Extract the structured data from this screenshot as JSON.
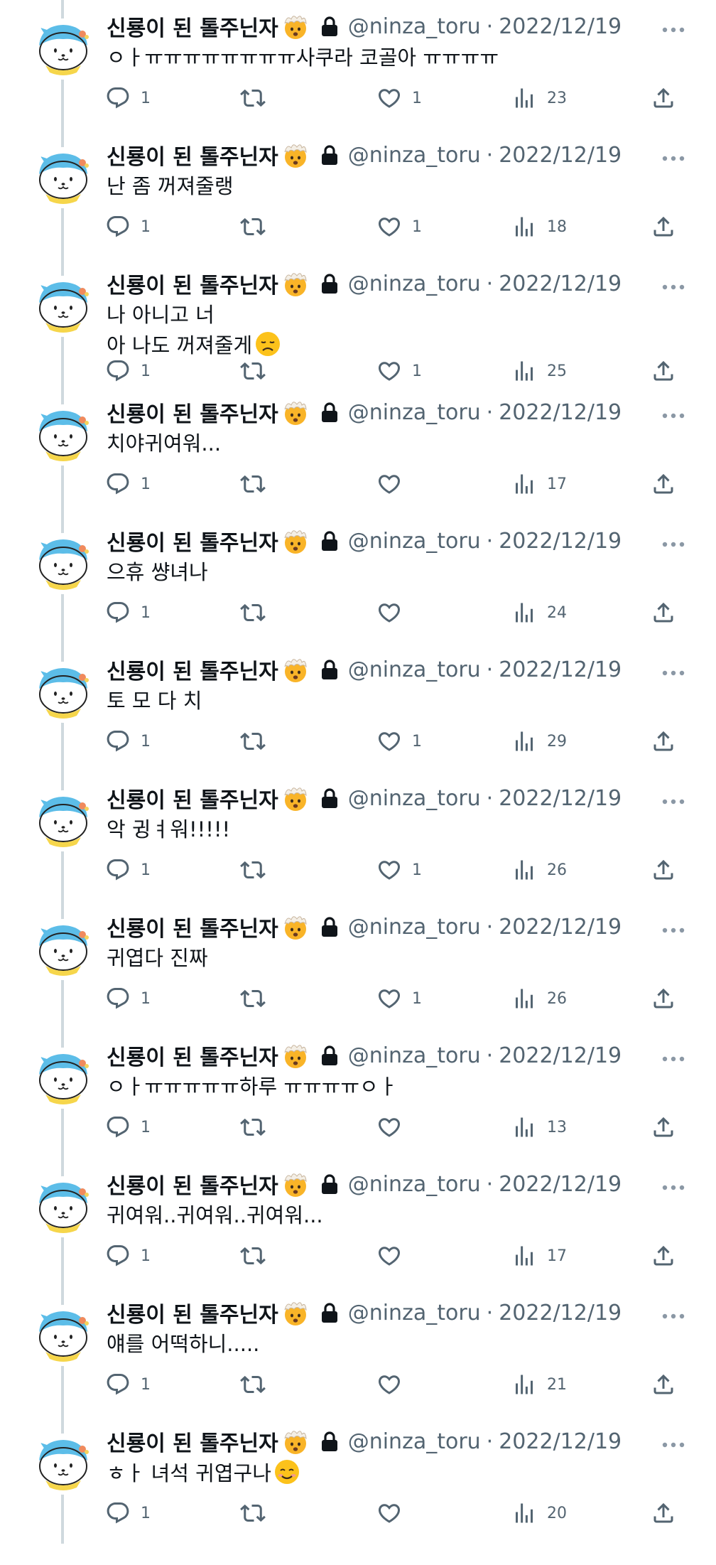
{
  "author": {
    "display_name": "신룡이 된 톨주닌자",
    "handle": "@ninza_toru",
    "name_emoji": "exploding-head-emoji",
    "locked_icon": "lock-icon",
    "avatar": "shark-hood-character-avatar"
  },
  "separator": "·",
  "colors": {
    "text": "#0f1419",
    "secondary": "#536471",
    "thread_line": "#cfd9de"
  },
  "icons": [
    "reply-icon",
    "retweet-icon",
    "like-icon",
    "views-icon",
    "share-icon",
    "more-icon"
  ],
  "tweets": [
    {
      "date": "2022/12/19",
      "text": "ㅇㅏㅠㅠㅠㅠㅠㅠㅠㅠ사쿠라 코골아 ㅠㅠㅠㅠ",
      "replies": "1",
      "likes": "1",
      "views": "23"
    },
    {
      "date": "2022/12/19",
      "text": "난 좀 꺼져줄랭",
      "replies": "1",
      "likes": "1",
      "views": "18"
    },
    {
      "date": "2022/12/19",
      "text": "나 아니고 너\n아 나도 꺼져줄게",
      "trailing_emoji": "disappointed-face-emoji",
      "replies": "1",
      "likes": "1",
      "views": "25"
    },
    {
      "date": "2022/12/19",
      "text": "치야귀여워...",
      "replies": "1",
      "likes": "",
      "views": "17"
    },
    {
      "date": "2022/12/19",
      "text": "으휴 썅녀나",
      "replies": "1",
      "likes": "",
      "views": "24"
    },
    {
      "date": "2022/12/19",
      "text": "토 모 다 치",
      "replies": "1",
      "likes": "1",
      "views": "29"
    },
    {
      "date": "2022/12/19",
      "text": "악 귕ㅕ워!!!!!",
      "replies": "1",
      "likes": "1",
      "views": "26"
    },
    {
      "date": "2022/12/19",
      "text": "귀엽다 진짜",
      "replies": "1",
      "likes": "1",
      "views": "26"
    },
    {
      "date": "2022/12/19",
      "text": "ㅇㅏㅠㅠㅠㅠㅠ하루 ㅠㅠㅠㅠㅇㅏ",
      "replies": "1",
      "likes": "",
      "views": "13"
    },
    {
      "date": "2022/12/19",
      "text": "귀여워..귀여워..귀여워...",
      "replies": "1",
      "likes": "",
      "views": "17"
    },
    {
      "date": "2022/12/19",
      "text": "얘를 어떡하니.....",
      "replies": "1",
      "likes": "",
      "views": "21"
    },
    {
      "date": "2022/12/19",
      "text": "ㅎㅏ 녀석 귀엽구나",
      "trailing_emoji": "smiling-face-emoji",
      "replies": "1",
      "likes": "",
      "views": "20"
    }
  ]
}
